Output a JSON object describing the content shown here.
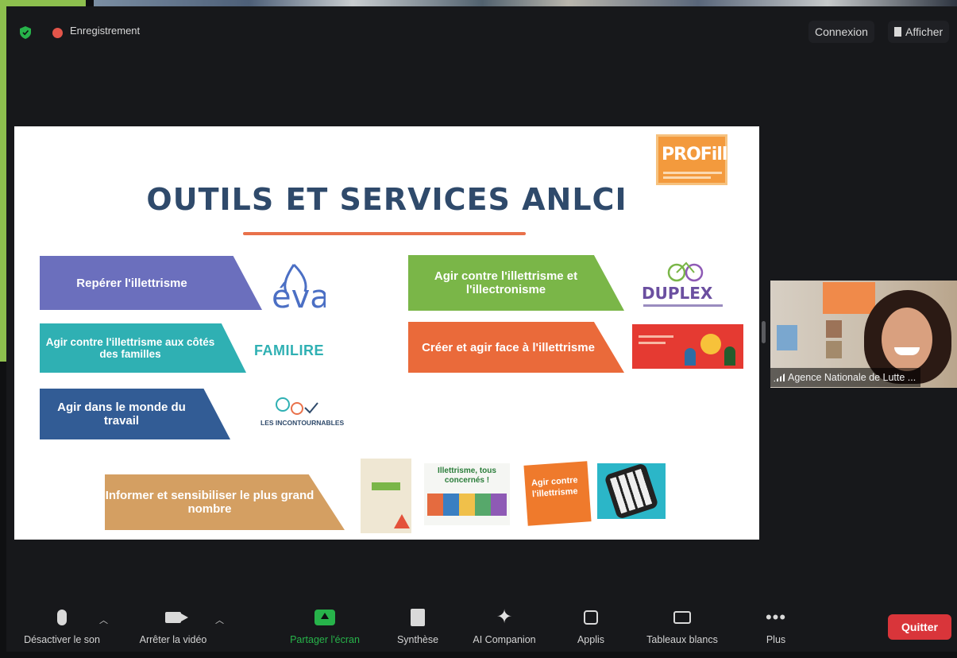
{
  "topbar": {
    "recording_label": "Enregistrement",
    "connexion_label": "Connexion",
    "afficher_label": "Afficher"
  },
  "slide": {
    "logo_text": "PROFill",
    "title": "OUTILS ET SERVICES ANLCI",
    "banners": {
      "reperer": "Repérer l'illettrisme",
      "familles": "Agir contre l'illettrisme aux côtés des familles",
      "travail": "Agir dans le monde du travail",
      "illectronisme": "Agir contre l'illettrisme et l'illectronisme",
      "creer": "Créer et agir face à l'illettrisme",
      "informer": "Informer et sensibiliser le plus grand nombre"
    },
    "logos": {
      "eva": "éva",
      "familire": "FAMILIRE",
      "incontournables": "LES INCONTOURNABLES",
      "duplex": "DUPLEX"
    },
    "thumbnails": {
      "concernes": "Illettrisme, tous concernés !",
      "agir": "Agir contre l'illettrisme"
    }
  },
  "participant": {
    "name": "Agence Nationale de Lutte ..."
  },
  "toolbar": {
    "mute_label": "Désactiver le son",
    "video_label": "Arrêter la vidéo",
    "share_label": "Partager l'écran",
    "summary_label": "Synthèse",
    "ai_label": "AI Companion",
    "apps_label": "Applis",
    "whiteboards_label": "Tableaux blancs",
    "more_label": "Plus",
    "quit_label": "Quitter"
  },
  "colors": {
    "accent_share": "#27b34a",
    "quit": "#d9353a",
    "recording": "#e3554a",
    "secure": "#27b34a",
    "title": "#2f4a6b"
  },
  "icons": {
    "secure": "shield-icon",
    "recording": "recording-dot-icon",
    "mute": "microphone-icon",
    "video": "video-camera-icon",
    "share": "share-screen-icon",
    "summary": "document-icon",
    "ai": "sparkle-icon",
    "apps": "apps-icon",
    "whiteboards": "whiteboard-icon",
    "more": "more-dots-icon"
  }
}
